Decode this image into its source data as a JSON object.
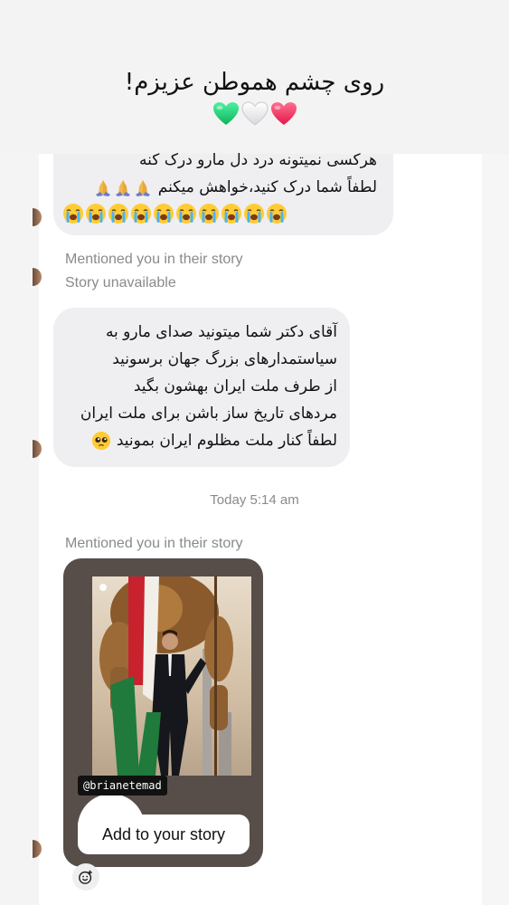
{
  "header": {
    "title": "روی چشم هموطن عزیزم!",
    "hearts": [
      "green-heart",
      "white-heart",
      "pink-heart"
    ]
  },
  "messages": [
    {
      "lines": [
        "هرکسی نمیتونه درد دل مارو درک کنه",
        "لطفاً شما درک کنید،خواهش میکنم"
      ],
      "emoji": [
        "folded-hands x3",
        "loudly-crying-face x10"
      ]
    },
    {
      "mention": "Mentioned you in their story",
      "status": "Story unavailable"
    },
    {
      "lines": [
        "آقای دکتر شما میتونید صدای مارو به",
        "سیاستمدارهای بزرگ جهان برسونید",
        "از طرف ملت ایران بهشون بگید",
        "مردهای تاریخ ساز باشن برای ملت ایران",
        "لطفاً کنار ملت مظلوم ایران بمونید"
      ],
      "emoji": [
        "pleading-face"
      ]
    }
  ],
  "timestamp": "Today 5:14 am",
  "story": {
    "mention": "Mentioned you in their story",
    "tag": "@brianetemad",
    "add_button": "Add to your story"
  },
  "colors": {
    "bubble": "#efeef1",
    "story_card": "#574e4a",
    "meta_text": "#8a8a8a"
  }
}
